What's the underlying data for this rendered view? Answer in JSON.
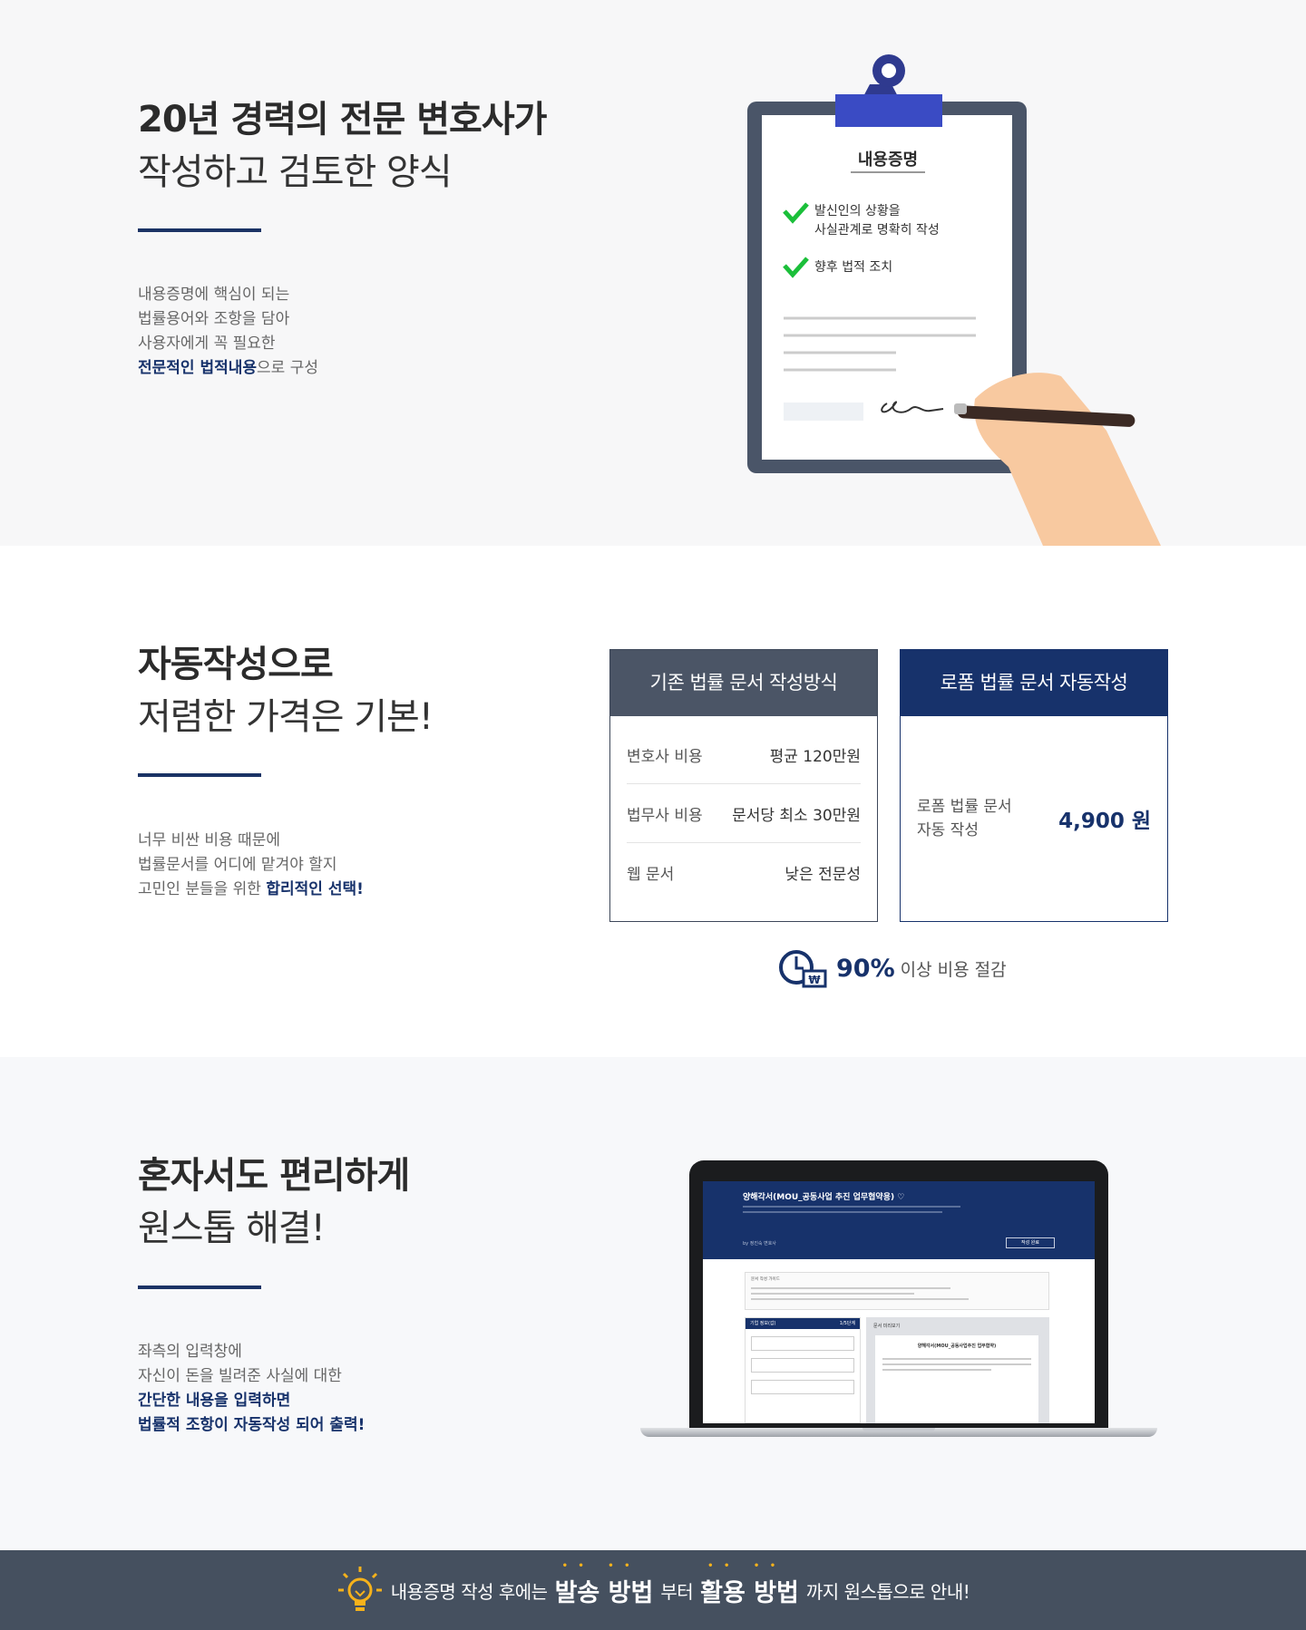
{
  "section1": {
    "title_bold": "20년 경력의 전문 변호사가",
    "title_light": "작성하고 검토한 양식",
    "desc_lines": [
      "내용증명에 핵심이 되는",
      "법률용어와 조항을 담아",
      "사용자에게 꼭 필요한"
    ],
    "desc_em": "전문적인 법적내용",
    "desc_tail": "으로 구성",
    "clipboard": {
      "doc_title": "내용증명",
      "check1_line1": "발신인의 상황을",
      "check1_line2": "사실관계로 명확히 작성",
      "check2": "향후 법적 조치"
    }
  },
  "section2": {
    "title_bold": "자동작성으로",
    "title_light": "저렴한 가격은 기본!",
    "desc_lines": [
      "너무 비싼 비용 때문에",
      "법률문서를 어디에 맡겨야 할지"
    ],
    "desc_prefix": "고민인 분들을 위한 ",
    "desc_em": "합리적인 선택!",
    "traditional": {
      "header": "기존 법률 문서 작성방식",
      "rows": [
        {
          "label": "변호사 비용",
          "value": "평균 120만원"
        },
        {
          "label": "법무사 비용",
          "value": "문서당 최소 30만원"
        },
        {
          "label": "웹 문서",
          "value": "낮은 전문성"
        }
      ]
    },
    "auto": {
      "header": "로폼 법률 문서 자동작성",
      "label_line1": "로폼 법률 문서",
      "label_line2": "자동 작성",
      "price": "4,900 원"
    },
    "saving": {
      "percent": "90%",
      "text": "이상 비용 절감"
    }
  },
  "section3": {
    "title_bold": "혼자서도 편리하게",
    "title_light": "원스톱 해결!",
    "desc_lines": [
      "좌측의 입력창에",
      "자신이 돈을 빌려준 사실에 대한"
    ],
    "desc_em_lines": [
      "간단한 내용을 입력하면",
      "법률적 조항이 자동작성 되어 출력!"
    ],
    "laptop": {
      "title": "양해각서(MOU_공동사업 추진 업무협약용) ♡",
      "by": "by 정진숙 변호사",
      "button": "작성 완료",
      "guide_title": "문서 작성 가이드",
      "left_panel": "기업 정보(갑)",
      "left_panel_page": "1/5단계",
      "right_panel": "문서 미리보기",
      "doc_title": "양해각서(MOU_공동사업추진 업무협약)"
    }
  },
  "footer": {
    "pre": "내용증명 작성 후에는",
    "big1": "발송 방법",
    "mid": "부터",
    "big2": "활용 방법",
    "post": "까지 원스톱으로 안내!"
  },
  "colors": {
    "navy": "#17326b",
    "slate": "#4b5566",
    "green_check": "#1bbf3a",
    "bar": "#45505f",
    "bulb": "#f6b21b"
  }
}
